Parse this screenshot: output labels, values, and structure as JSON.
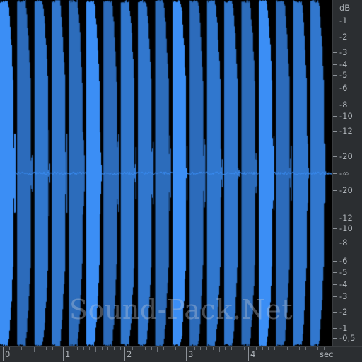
{
  "colors": {
    "background": "#000000",
    "waveform": "#3b8ef5",
    "noise_floor": "#3b8ef5",
    "ruler_bg": "#2b2e31",
    "ruler_text": "#aeb3b8"
  },
  "db_ruler": {
    "unit": "dB",
    "labels": [
      "-1",
      "-2",
      "-3",
      "-4",
      "-5",
      "-6",
      "-8",
      "-10",
      "-12",
      "-20",
      "-∞",
      "-20",
      "-12",
      "-10",
      "-8",
      "-6",
      "-5",
      "-4",
      "-3",
      "-2",
      "-1",
      "-0,5"
    ]
  },
  "time_ruler": {
    "labels": [
      "0",
      "1",
      "2",
      "3",
      "4"
    ],
    "unit": "sec"
  },
  "waveform": {
    "duration_sec": 5.2,
    "burst_count": 19
  },
  "watermark": "Sound-Pack.Net"
}
